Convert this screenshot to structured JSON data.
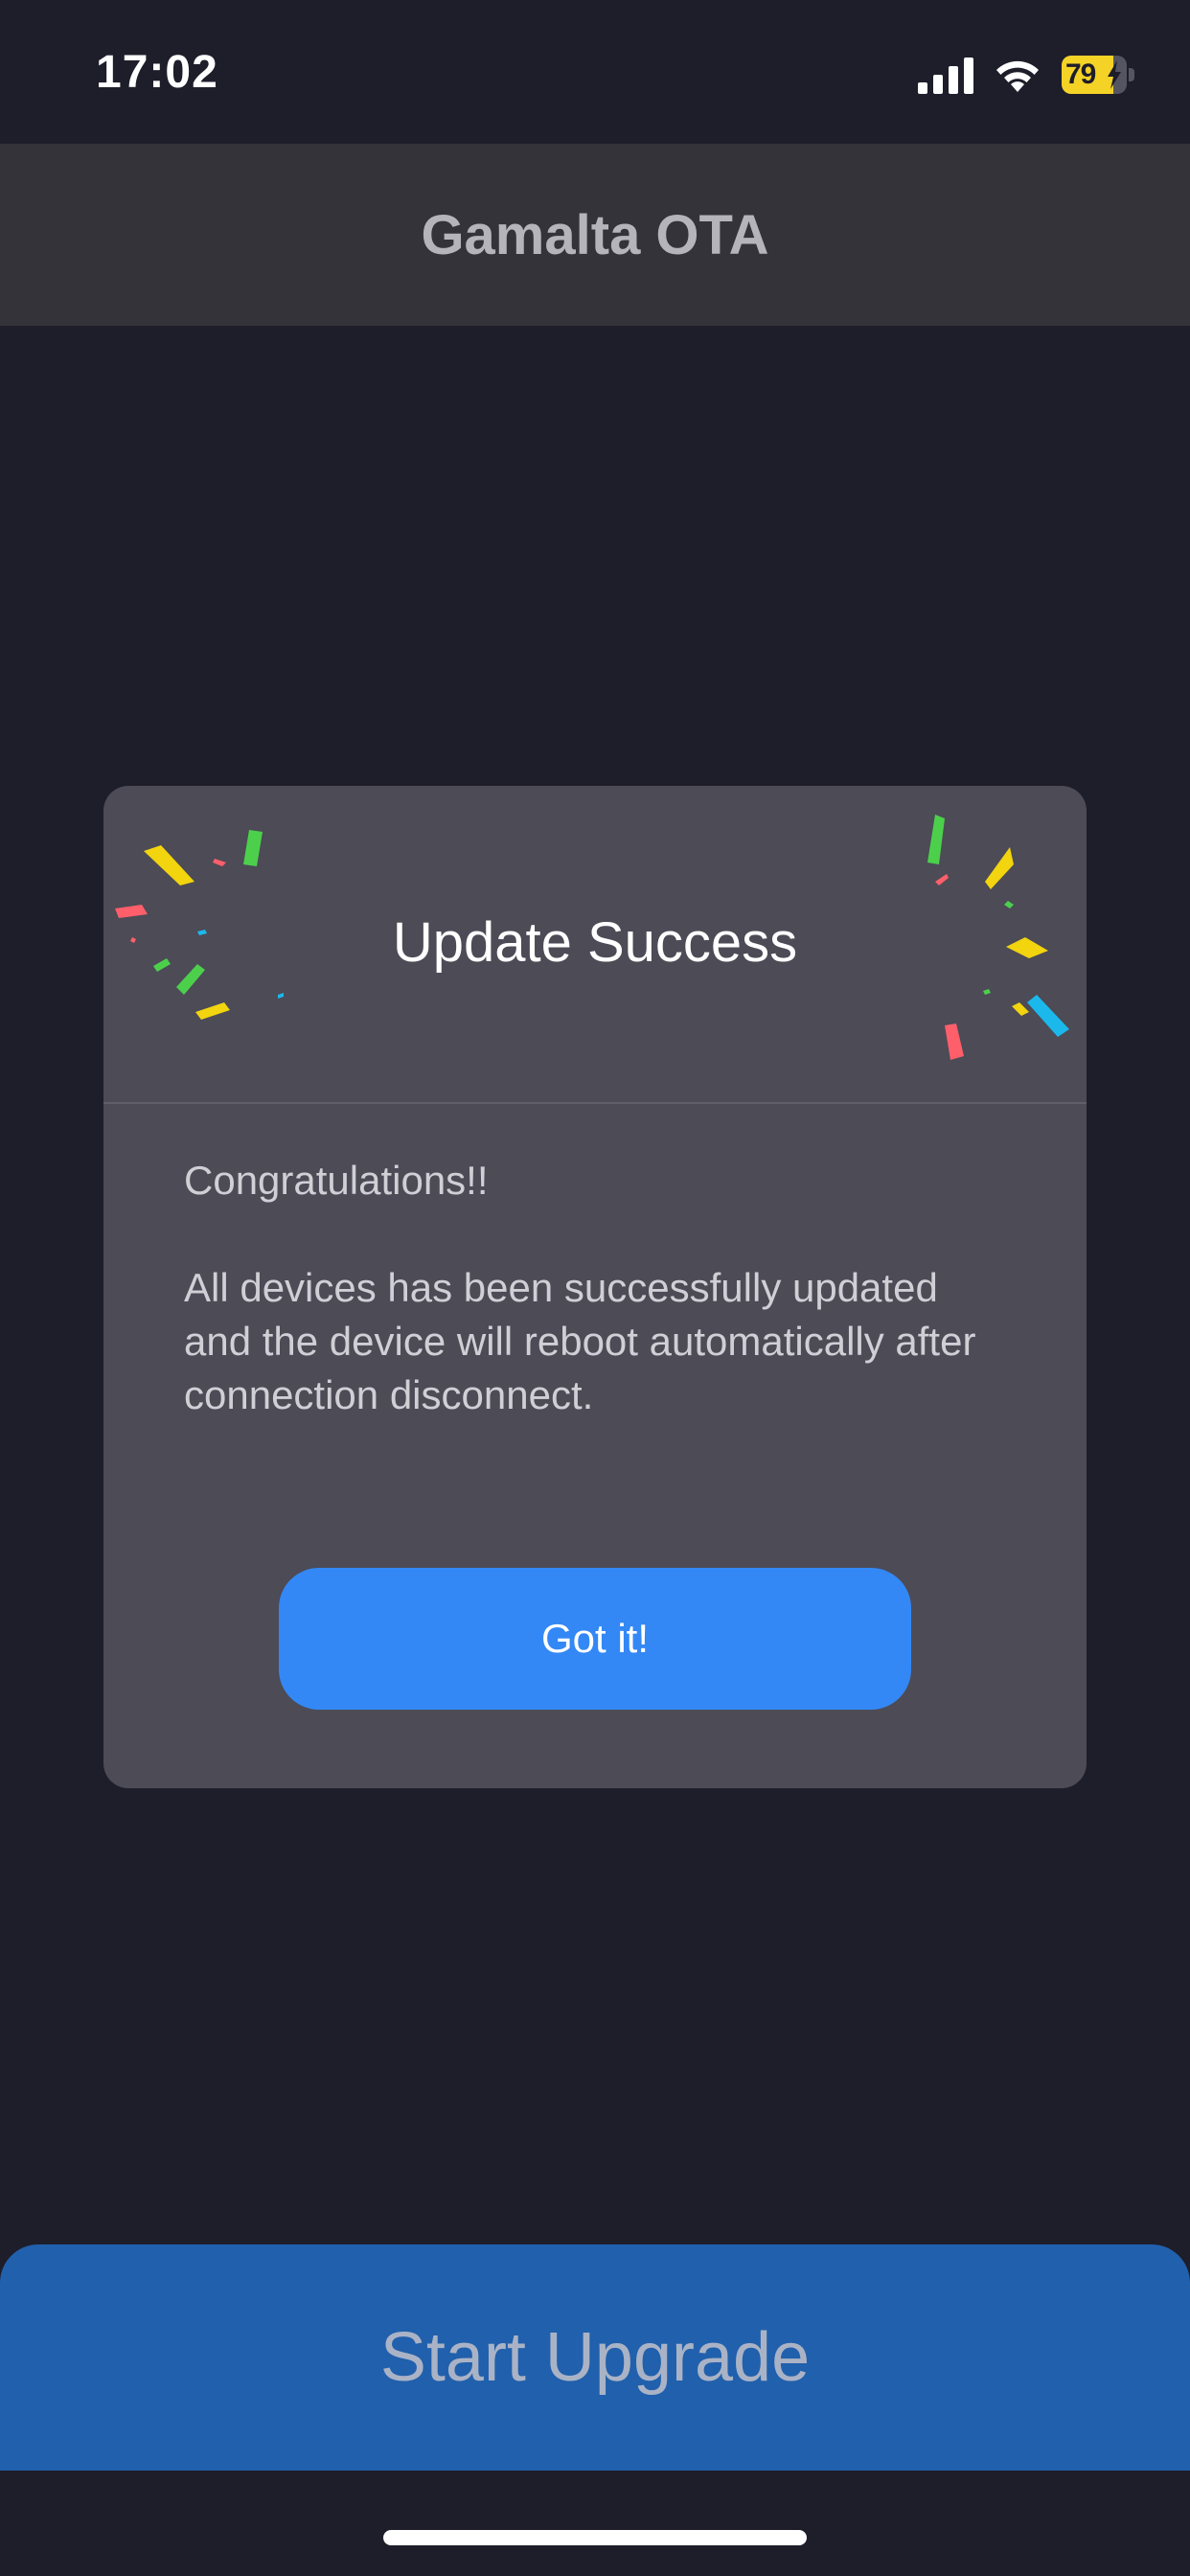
{
  "status_bar": {
    "time": "17:02",
    "battery_level": "79",
    "battery_fraction": 0.79,
    "icons": [
      "signal-icon",
      "wifi-icon",
      "battery-icon",
      "charging-bolt-icon"
    ]
  },
  "nav": {
    "title": "Gamalta OTA"
  },
  "dialog": {
    "title": "Update Success",
    "congrats": "Congratulations!!",
    "message": "All devices has been successfully updated and the device will reboot automatically after connection disconnect.",
    "button_label": "Got it!"
  },
  "footer": {
    "start_upgrade_label": "Start Upgrade"
  },
  "colors": {
    "background": "#1e1d2a",
    "nav_bar": "#343339",
    "dialog": "#4c4b56",
    "primary_button": "#3388f5",
    "start_button": "#2160ac",
    "battery": "#f4d326",
    "confetti": [
      "#f2d40f",
      "#ff5f6a",
      "#4cd04c",
      "#1bb8ec"
    ]
  }
}
